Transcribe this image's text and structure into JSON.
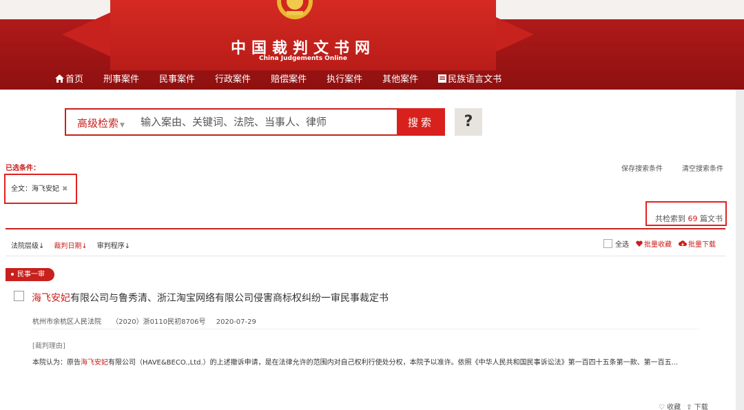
{
  "header": {
    "title": "中国裁判文书网",
    "subtitle": "China Judgements Online",
    "nav": [
      {
        "label": "首页",
        "icon": "home-icon"
      },
      {
        "label": "刑事案件"
      },
      {
        "label": "民事案件"
      },
      {
        "label": "行政案件"
      },
      {
        "label": "赔偿案件"
      },
      {
        "label": "执行案件"
      },
      {
        "label": "其他案件"
      },
      {
        "label": "民族语言文书",
        "icon": "document-icon"
      }
    ]
  },
  "search": {
    "advanced_label": "高级检索",
    "placeholder": "输入案由、关键词、法院、当事人、律师",
    "button_label": "搜索",
    "help_label": "?"
  },
  "conditions": {
    "label": "已选条件：",
    "save_label": "保存搜索条件",
    "clear_label": "清空搜索条件",
    "tag": "全文：海飞安妃",
    "tag_close": "✖"
  },
  "result_count": {
    "prefix": "共检索到",
    "count": "69",
    "suffix": "篇文书"
  },
  "sort": {
    "items": [
      "法院层级↓",
      "裁判日期↓",
      "审判程序↓"
    ],
    "active_index": 1
  },
  "bulk": {
    "select_all": "全选",
    "batch_collect": "批量收藏",
    "batch_download": "批量下载"
  },
  "result": {
    "case_type": "民事一审",
    "title_highlight": "海飞安妃",
    "title_rest": "有限公司与鲁秀清、浙江淘宝网络有限公司侵害商标权纠纷一审民事裁定书",
    "court": "杭州市余杭区人民法院",
    "case_no": "（2020）浙0110民初8706号",
    "date": "2020-07-29",
    "reason_label": "[裁判理由]",
    "snippet_pre": "本院认为：原告",
    "snippet_highlight": "海飞安妃",
    "snippet_post": "有限公司（HAVE&BECO.,Ltd.）的上述撤诉申请，是在法律允许的范围内对自己权利行使处分权，本院予以准许。依照《中华人民共和国民事诉讼法》第一百四十五条第一款、第一百五...",
    "collect_label": "♡ 收藏",
    "download_label": "⇪ 下载"
  },
  "colors": {
    "brand_red": "#c8201c",
    "header_dark_red": "#8e1010"
  }
}
